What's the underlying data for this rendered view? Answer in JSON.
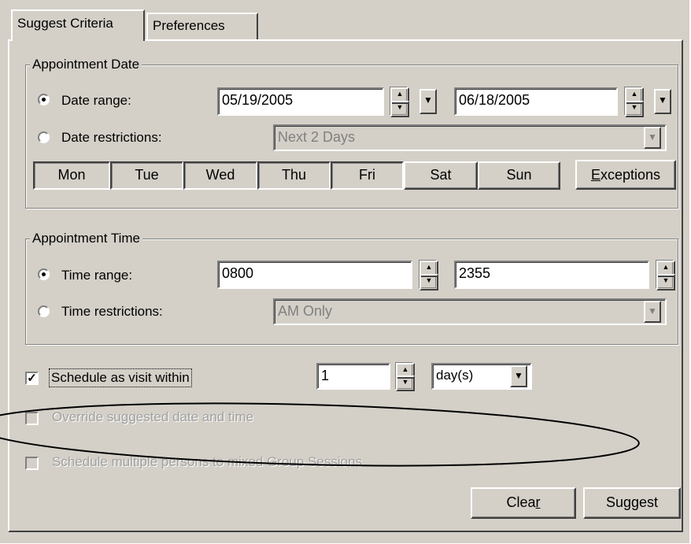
{
  "tabs": [
    {
      "label": "Suggest Criteria",
      "active": true
    },
    {
      "label": "Preferences",
      "active": false
    }
  ],
  "appointment_date": {
    "legend": "Appointment Date",
    "date_range_label": "Date range:",
    "date_range_selected": true,
    "start_date": "05/19/2005",
    "end_date": "06/18/2005",
    "date_restrictions_label": "Date restrictions:",
    "date_restrictions_value": "Next 2 Days",
    "days": [
      {
        "label": "Mon",
        "pressed": true
      },
      {
        "label": "Tue",
        "pressed": true
      },
      {
        "label": "Wed",
        "pressed": true
      },
      {
        "label": "Thu",
        "pressed": true
      },
      {
        "label": "Fri",
        "pressed": true
      },
      {
        "label": "Sat",
        "pressed": false
      },
      {
        "label": "Sun",
        "pressed": false
      }
    ],
    "exceptions_label": "Exceptions",
    "exceptions_accel": "E"
  },
  "appointment_time": {
    "legend": "Appointment Time",
    "time_range_label": "Time range:",
    "time_range_selected": true,
    "start_time": "0800",
    "end_time": "2355",
    "time_restrictions_label": "Time restrictions:",
    "time_restrictions_value": "AM Only"
  },
  "schedule_visit": {
    "label": "Schedule as visit within",
    "checked": true,
    "count": "1",
    "unit": "day(s)"
  },
  "override": {
    "label": "Override suggested date and time",
    "checked": false,
    "enabled": false
  },
  "multiple_persons": {
    "label": "Schedule multiple persons to mixed Group Sessions",
    "checked": false,
    "enabled": false
  },
  "buttons": {
    "clear_label": "Clear",
    "clear_accel": "r",
    "suggest_label": "Suggest"
  },
  "icons": {
    "spin_up": "spin-up-icon",
    "spin_down": "spin-down-icon",
    "dropdown": "chevron-down-icon",
    "checkmark": "checkmark-icon"
  },
  "colors": {
    "face": "#d4d0c8",
    "disabled_text": "#808080",
    "annotation": "#000000"
  }
}
